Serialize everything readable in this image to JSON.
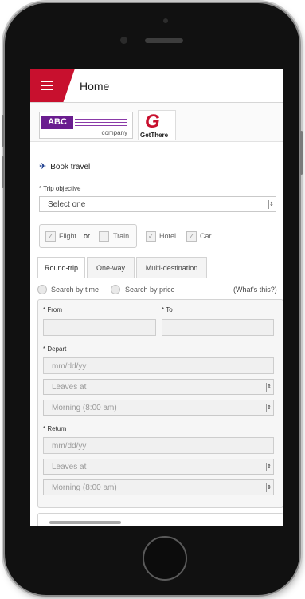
{
  "header": {
    "title": "Home"
  },
  "logos": {
    "abc_text": "ABC",
    "abc_company": "company",
    "getthere_text": "GetThere"
  },
  "book_travel": {
    "label": "Book travel"
  },
  "trip_objective": {
    "label": "* Trip objective",
    "selected": "Select one"
  },
  "travel_types": {
    "flight": "Flight",
    "or": "or",
    "train": "Train",
    "hotel": "Hotel",
    "car": "Car"
  },
  "tabs": [
    "Round-trip",
    "One-way",
    "Multi-destination"
  ],
  "search": {
    "by_time": "Search by time",
    "by_price": "Search by price",
    "whats_this": "(What's this?)"
  },
  "fields": {
    "from_label": "* From",
    "to_label": "* To",
    "depart_label": "* Depart",
    "depart_date_placeholder": "mm/dd/yy",
    "depart_leaves": "Leaves at",
    "depart_time": "Morning (8:00 am)",
    "return_label": "* Return",
    "return_date_placeholder": "mm/dd/yy",
    "return_leaves": "Leaves at",
    "return_time": "Morning (8:00 am)"
  },
  "colors": {
    "brand_red": "#c8102e",
    "abc_purple": "#6a1d8f",
    "icon_blue": "#1f3f8f"
  }
}
